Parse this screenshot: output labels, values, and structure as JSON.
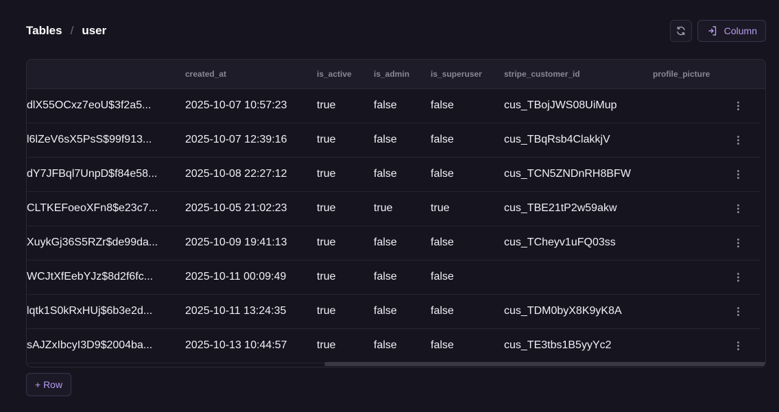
{
  "breadcrumb": {
    "root": "Tables",
    "separator": "/",
    "current": "user"
  },
  "toolbar": {
    "refresh_icon": "refresh-icon",
    "column_icon": "add-column-icon",
    "column_label": "Column"
  },
  "columns": [
    "created_at",
    "is_active",
    "is_admin",
    "is_superuser",
    "stripe_customer_id",
    "profile_picture"
  ],
  "rows": [
    {
      "hash": "dlX55OCxz7eoU$3f2a5...",
      "created_at": "2025-10-07 10:57:23",
      "is_active": "true",
      "is_admin": "false",
      "is_superuser": "false",
      "stripe_customer_id": "cus_TBojJWS08UiMup"
    },
    {
      "hash": "l6lZeV6sX5PsS$99f913...",
      "created_at": "2025-10-07 12:39:16",
      "is_active": "true",
      "is_admin": "false",
      "is_superuser": "false",
      "stripe_customer_id": "cus_TBqRsb4ClakkjV"
    },
    {
      "hash": "dY7JFBql7UnpD$f84e58...",
      "created_at": "2025-10-08 22:27:12",
      "is_active": "true",
      "is_admin": "false",
      "is_superuser": "false",
      "stripe_customer_id": "cus_TCN5ZNDnRH8BFW"
    },
    {
      "hash": "CLTKEFoeoXFn8$e23c7...",
      "created_at": "2025-10-05 21:02:23",
      "is_active": "true",
      "is_admin": "true",
      "is_superuser": "true",
      "stripe_customer_id": "cus_TBE21tP2w59akw"
    },
    {
      "hash": "XuykGj36S5RZr$de99da...",
      "created_at": "2025-10-09 19:41:13",
      "is_active": "true",
      "is_admin": "false",
      "is_superuser": "false",
      "stripe_customer_id": "cus_TCheyv1uFQ03ss"
    },
    {
      "hash": "WCJtXfEebYJz$8d2f6fc...",
      "created_at": "2025-10-11 00:09:49",
      "is_active": "true",
      "is_admin": "false",
      "is_superuser": "false",
      "stripe_customer_id": ""
    },
    {
      "hash": "lqtk1S0kRxHUj$6b3e2d...",
      "created_at": "2025-10-11 13:24:35",
      "is_active": "true",
      "is_admin": "false",
      "is_superuser": "false",
      "stripe_customer_id": "cus_TDM0byX8K9yK8A"
    },
    {
      "hash": "sAJZxIbcyI3D9$2004ba...",
      "created_at": "2025-10-13 10:44:57",
      "is_active": "true",
      "is_admin": "false",
      "is_superuser": "false",
      "stripe_customer_id": "cus_TE3tbs1B5yyYc2"
    }
  ],
  "row_menu_icon": "more-vertical-icon",
  "add_row_label": "+ Row",
  "colors": {
    "background": "#16141f",
    "accent": "#b79cf2",
    "header_bg": "#1e1c28"
  }
}
